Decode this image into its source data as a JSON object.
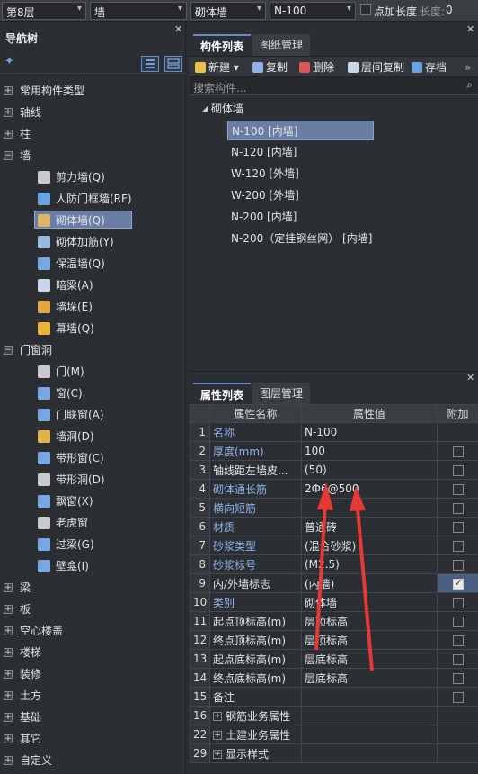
{
  "topbar": {
    "floor": "第8层",
    "category": "墙",
    "type": "砌体墙",
    "name": "N-100",
    "add_length_label": "点加长度",
    "length_label": "长度:",
    "length_value": "0"
  },
  "nav": {
    "title": "导航树",
    "items": [
      {
        "label": "常用构件类型",
        "level": 0,
        "expander": "+"
      },
      {
        "label": "轴线",
        "level": 0,
        "expander": "+"
      },
      {
        "label": "柱",
        "level": 0,
        "expander": "+"
      },
      {
        "label": "墙",
        "level": 0,
        "expander": "-"
      },
      {
        "label": "剪力墙(Q)",
        "level": 1,
        "icon": "shear-wall-icon",
        "color": "#c9c9c9"
      },
      {
        "label": "人防门框墙(RF)",
        "level": 1,
        "icon": "civil-defense-wall-icon",
        "color": "#6aa3e0"
      },
      {
        "label": "砌体墙(Q)",
        "level": 1,
        "icon": "masonry-wall-icon",
        "color": "#d9b765",
        "selected": true
      },
      {
        "label": "砌体加筋(Y)",
        "level": 1,
        "icon": "masonry-rebar-icon",
        "color": "#9ab8e0"
      },
      {
        "label": "保温墙(Q)",
        "level": 1,
        "icon": "insulation-wall-icon",
        "color": "#7aa7e0"
      },
      {
        "label": "暗梁(A)",
        "level": 1,
        "icon": "hidden-beam-icon",
        "color": "#c9d6ea"
      },
      {
        "label": "墙垛(E)",
        "level": 1,
        "icon": "wall-pier-icon",
        "color": "#e0a84a"
      },
      {
        "label": "幕墙(Q)",
        "level": 1,
        "icon": "curtain-wall-icon",
        "color": "#e8b43a"
      },
      {
        "label": "门窗洞",
        "level": 0,
        "expander": "-"
      },
      {
        "label": "门(M)",
        "level": 1,
        "icon": "door-icon",
        "color": "#c9c9c9"
      },
      {
        "label": "窗(C)",
        "level": 1,
        "icon": "window-icon",
        "color": "#7aa7e0"
      },
      {
        "label": "门联窗(A)",
        "level": 1,
        "icon": "door-window-icon",
        "color": "#7aa7e0"
      },
      {
        "label": "墙洞(D)",
        "level": 1,
        "icon": "wall-hole-icon",
        "color": "#e0b44a"
      },
      {
        "label": "带形窗(C)",
        "level": 1,
        "icon": "strip-window-icon",
        "color": "#7aa7e0"
      },
      {
        "label": "带形洞(D)",
        "level": 1,
        "icon": "strip-hole-icon",
        "color": "#c9c9c9"
      },
      {
        "label": "飘窗(X)",
        "level": 1,
        "icon": "bay-window-icon",
        "color": "#7aa7e0"
      },
      {
        "label": "老虎窗",
        "level": 1,
        "icon": "dormer-window-icon",
        "color": "#c9c9c9"
      },
      {
        "label": "过梁(G)",
        "level": 1,
        "icon": "lintel-icon",
        "color": "#7aa7e0"
      },
      {
        "label": "壁龛(I)",
        "level": 1,
        "icon": "niche-icon",
        "color": "#7aa7e0"
      },
      {
        "label": "梁",
        "level": 0,
        "expander": "+"
      },
      {
        "label": "板",
        "level": 0,
        "expander": "+"
      },
      {
        "label": "空心楼盖",
        "level": 0,
        "expander": "+"
      },
      {
        "label": "楼梯",
        "level": 0,
        "expander": "+"
      },
      {
        "label": "装修",
        "level": 0,
        "expander": "+"
      },
      {
        "label": "土方",
        "level": 0,
        "expander": "+"
      },
      {
        "label": "基础",
        "level": 0,
        "expander": "+"
      },
      {
        "label": "其它",
        "level": 0,
        "expander": "+"
      },
      {
        "label": "自定义",
        "level": 0,
        "expander": "+"
      }
    ]
  },
  "components": {
    "tabs": [
      "构件列表",
      "图纸管理"
    ],
    "toolbar": {
      "new": "新建",
      "copy": "复制",
      "delete": "删除",
      "floor_copy": "层间复制",
      "save": "存档"
    },
    "search_placeholder": "搜索构件...",
    "group": "砌体墙",
    "items": [
      {
        "label": "N-100 [内墙]",
        "selected": true
      },
      {
        "label": "N-120 [内墙]"
      },
      {
        "label": "W-120 [外墙]"
      },
      {
        "label": "W-200 [外墙]"
      },
      {
        "label": "N-200 [内墙]"
      },
      {
        "label": "N-200（定挂钢丝网） [内墙]"
      }
    ]
  },
  "properties": {
    "tabs": [
      "属性列表",
      "图层管理"
    ],
    "headers": [
      "属性名称",
      "属性值",
      "附加"
    ],
    "rows": [
      {
        "num": "1",
        "name": "名称",
        "value": "N-100",
        "blue": true,
        "check": "none"
      },
      {
        "num": "2",
        "name": "厚度(mm)",
        "value": "100",
        "blue": true,
        "check": "off"
      },
      {
        "num": "3",
        "name": "轴线距左墙皮...",
        "value": "(50)",
        "blue": false,
        "check": "off"
      },
      {
        "num": "4",
        "name": "砌体通长筋",
        "value": "2Ф6@500",
        "blue": true,
        "check": "off"
      },
      {
        "num": "5",
        "name": "横向短筋",
        "value": "",
        "blue": true,
        "check": "off"
      },
      {
        "num": "6",
        "name": "材质",
        "value": "普通砖",
        "blue": true,
        "check": "off"
      },
      {
        "num": "7",
        "name": "砂浆类型",
        "value": "(混合砂浆)",
        "blue": true,
        "check": "off"
      },
      {
        "num": "8",
        "name": "砂浆标号",
        "value": "(M2.5)",
        "blue": true,
        "check": "off"
      },
      {
        "num": "9",
        "name": "内/外墙标志",
        "value": "(内墙)",
        "blue": false,
        "check": "on"
      },
      {
        "num": "10",
        "name": "类别",
        "value": "砌体墙",
        "blue": true,
        "check": "off"
      },
      {
        "num": "11",
        "name": "起点顶标高(m)",
        "value": "层顶标高",
        "blue": false,
        "check": "off"
      },
      {
        "num": "12",
        "name": "终点顶标高(m)",
        "value": "层顶标高",
        "blue": false,
        "check": "off"
      },
      {
        "num": "13",
        "name": "起点底标高(m)",
        "value": "层底标高",
        "blue": false,
        "check": "off"
      },
      {
        "num": "14",
        "name": "终点底标高(m)",
        "value": "层底标高",
        "blue": false,
        "check": "off"
      },
      {
        "num": "15",
        "name": "备注",
        "value": "",
        "blue": false,
        "check": "off"
      },
      {
        "num": "16",
        "name": "钢筋业务属性",
        "value": "",
        "blue": false,
        "check": "none",
        "group": true
      },
      {
        "num": "22",
        "name": "土建业务属性",
        "value": "",
        "blue": false,
        "check": "none",
        "group": true
      },
      {
        "num": "29",
        "name": "显示样式",
        "value": "",
        "blue": false,
        "check": "none",
        "group": true
      }
    ]
  },
  "colors": {
    "accent": "#6a7ea5",
    "arrow": "#e53935",
    "link": "#8fb2e8"
  }
}
